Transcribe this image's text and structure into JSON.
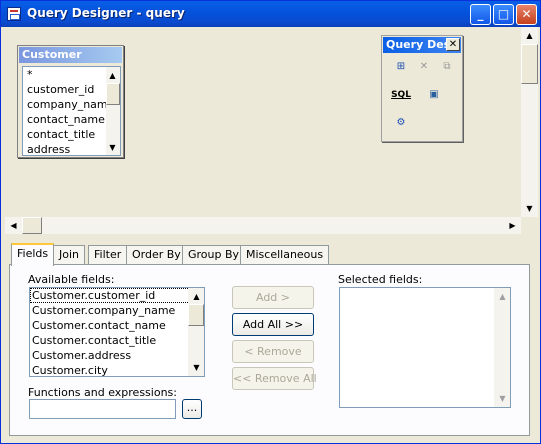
{
  "window": {
    "title": "Query Designer - query",
    "icons": {
      "app": "app-icon",
      "minimize": "minimize-icon",
      "maximize": "maximize-icon",
      "close": "close-icon"
    }
  },
  "table": {
    "caption": "Customer",
    "fields": [
      "*",
      "customer_id",
      "company_name",
      "contact_name",
      "contact_title",
      "address"
    ]
  },
  "palette": {
    "caption": "Query Des",
    "sql_label": "SQL"
  },
  "tabs": [
    "Fields",
    "Join",
    "Filter",
    "Order By",
    "Group By",
    "Miscellaneous"
  ],
  "active_tab": "Fields",
  "fields_tab": {
    "available_label": "Available fields:",
    "available_fields": [
      "Customer.customer_id",
      "Customer.company_name",
      "Customer.contact_name",
      "Customer.contact_title",
      "Customer.address",
      "Customer.city"
    ],
    "selected_index": 0,
    "selected_label": "Selected fields:",
    "functions_label": "Functions and expressions:",
    "functions_value": "",
    "ellipsis_label": "...",
    "buttons": {
      "add": "Add >",
      "add_all": "Add All >>",
      "remove": "< Remove",
      "remove_all": "<< Remove All"
    }
  }
}
